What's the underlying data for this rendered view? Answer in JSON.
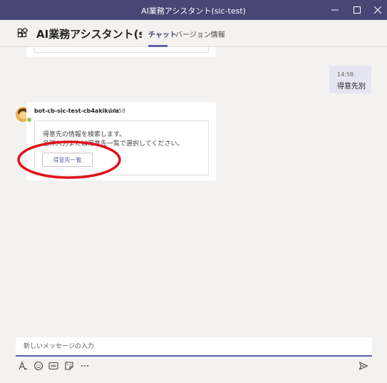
{
  "window": {
    "title": "AI業務アシスタント(sic-test)"
  },
  "header": {
    "app_name": "AI業務アシスタント(sic-test)",
    "tabs": [
      {
        "label": "チャット"
      },
      {
        "label": "バージョン情報"
      }
    ]
  },
  "messages": {
    "user": {
      "time": "14:58",
      "text": "得意先別"
    },
    "bot": {
      "name": "bot-cb-sic-test-cb4akikura",
      "time": "14:58",
      "line1": "得意先の情報を検索します。",
      "line2": "名称入力または得意先一覧で選択してください。",
      "button_label": "得意先一覧"
    }
  },
  "compose": {
    "placeholder": "新しいメッセージの入力"
  },
  "colors": {
    "titlebar": "#464775",
    "accent": "#6264a7",
    "annotation": "#e0101a"
  }
}
